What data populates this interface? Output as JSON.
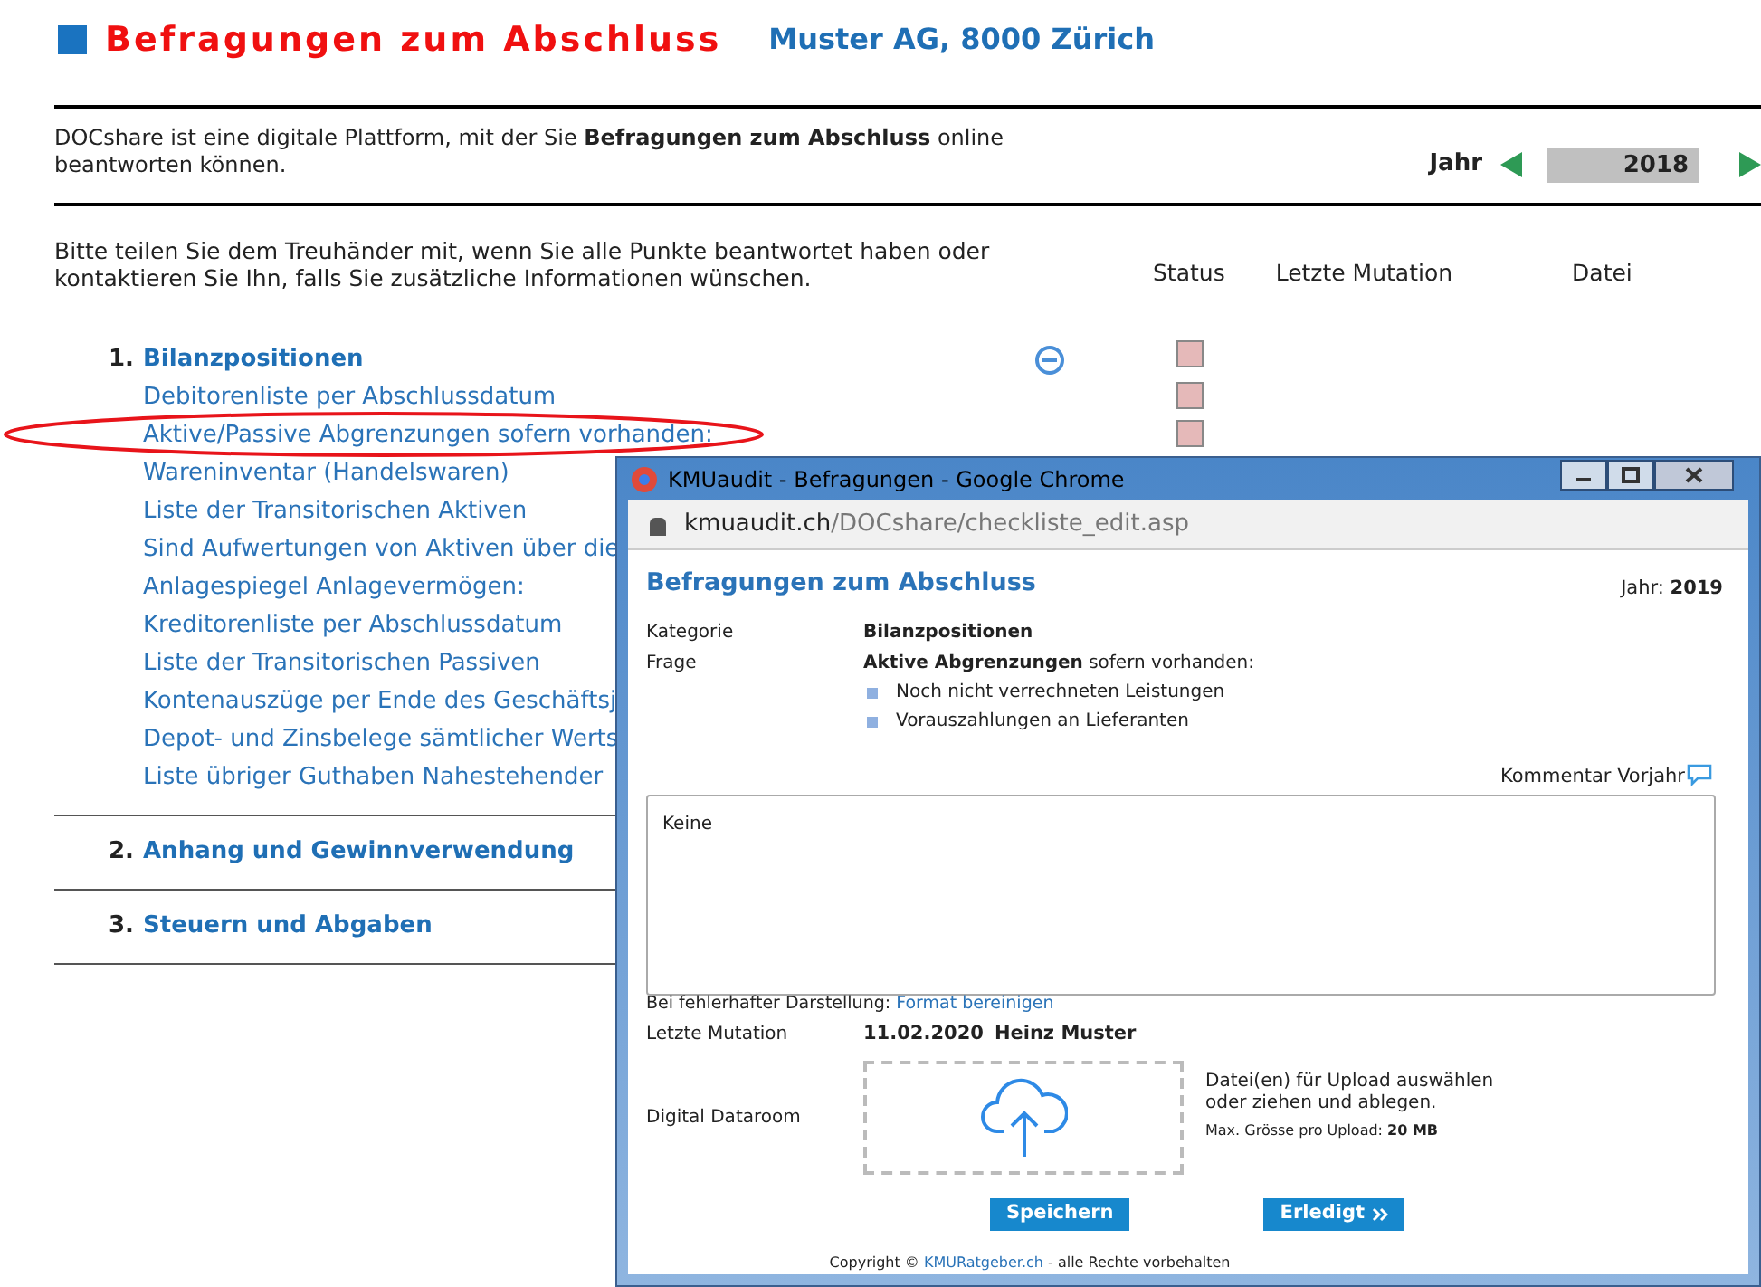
{
  "header": {
    "title": "Befragungen zum Abschluss",
    "company": "Muster AG, 8000 Zürich"
  },
  "intro": "DOCshare ist eine digitale Plattform, mit der Sie **Befragungen zum Abschluss** online beantworten können.",
  "year": {
    "label": "Jahr",
    "value": "2018"
  },
  "instruction": "Bitte teilen Sie dem Treuhänder mit, wenn Sie alle Punkte beantwortet haben oder kontaktieren Sie Ihn, falls Sie zusätzliche Informationen wünschen.",
  "columns": [
    "Status",
    "Letzte Mutation",
    "Datei"
  ],
  "sections": [
    {
      "number": "1.",
      "title": "Bilanzpositionen",
      "expanded": true,
      "status_open": true,
      "items": [
        {
          "label": "Debitorenliste per Abschlussdatum",
          "status_open": true
        },
        {
          "label": "Aktive/Passive Abgrenzungen sofern vorhanden:",
          "status_open": true
        },
        {
          "label": "Wareninventar (Handelswaren)"
        },
        {
          "label": "Liste der Transitorischen Aktiven"
        },
        {
          "label": "Sind Aufwertungen von Aktiven über die"
        },
        {
          "label": "Anlagespiegel Anlagevermögen:"
        },
        {
          "label": "Kreditorenliste per Abschlussdatum"
        },
        {
          "label": "Liste der Transitorischen Passiven"
        },
        {
          "label": "Kontenauszüge per Ende des Geschäftsj"
        },
        {
          "label": "Depot- und Zinsbelege sämtlicher Werts"
        },
        {
          "label": "Liste übriger Guthaben Nahestehender"
        }
      ]
    },
    {
      "number": "2.",
      "title": "Anhang und Gewinnverwendung",
      "expanded": false
    },
    {
      "number": "3.",
      "title": "Steuern und Abgaben",
      "expanded": false
    }
  ],
  "popup": {
    "window_title": "KMUaudit - Befragungen - Google Chrome",
    "url_host": "kmuaudit.ch",
    "url_path": "/DOCshare/checkliste_edit.asp",
    "heading": "Befragungen zum Abschluss",
    "year_label": "Jahr:",
    "year": "2019",
    "category_label": "Kategorie",
    "category": "Bilanzpositionen",
    "question_label": "Frage",
    "question": "**Aktive Abgrenzungen** sofern vorhanden:",
    "bullets": [
      "Noch nicht verrechneten Leistungen",
      "Vorauszahlungen an Lieferanten"
    ],
    "comment_link": "Kommentar Vorjahr",
    "comment": "Keine",
    "format_hint": "Bei fehlerhafter Darstellung:",
    "format_link": "Format bereinigen",
    "mutation_label": "Letzte Mutation",
    "mutation_date": "11.02.2020",
    "mutation_user": "Heinz Muster",
    "dataroom_label": "Digital Dataroom",
    "upload_text": "Datei(en) für Upload auswählen oder ziehen und ablegen.",
    "max_label": "Max. Grösse pro Upload:",
    "max_value": "20 MB",
    "buttons": [
      {
        "label": "Speichern",
        "kind": "save"
      },
      {
        "label": "Erledigt",
        "kind": "next"
      }
    ],
    "copyright_prefix": "Copyright ©",
    "copyright_link": "KMURatgeber.ch",
    "copyright_suffix": "- alle Rechte vorbehalten"
  }
}
